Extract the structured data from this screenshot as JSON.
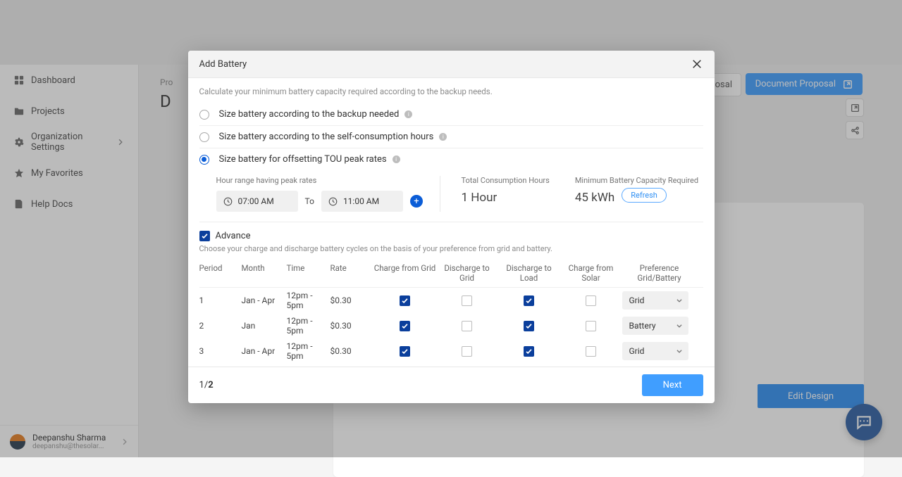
{
  "sidebar": {
    "items": [
      {
        "label": "Dashboard",
        "icon": "grid"
      },
      {
        "label": "Projects",
        "icon": "folder"
      },
      {
        "label": "Organization Settings",
        "icon": "gear",
        "expandable": true
      },
      {
        "label": "My Favorites",
        "icon": "star"
      },
      {
        "label": "Help Docs",
        "icon": "doc"
      }
    ],
    "user": {
      "name": "Deepanshu Sharma",
      "email": "deepanshu@thesolar..."
    }
  },
  "page": {
    "breadcrumb": "Pro",
    "title_initial": "D",
    "doc_proposal": "Document Proposal",
    "ghost_suffix": "osal",
    "edit_design": "Edit Design"
  },
  "modal": {
    "title": "Add Battery",
    "subtitle": "Calculate your minimum battery capacity required according to the backup needs.",
    "options": [
      {
        "label": "Size battery according to the backup needed",
        "selected": false
      },
      {
        "label": "Size battery according to the self-consumption hours",
        "selected": false
      },
      {
        "label": "Size battery for offsetting TOU peak rates",
        "selected": true
      }
    ],
    "hour_range_label": "Hour range having peak rates",
    "from_time": "07:00 AM",
    "to_label": "To",
    "to_time": "11:00 AM",
    "stats": {
      "total_label": "Total Consumption Hours",
      "total_value": "1 Hour",
      "min_label": "Minimum Battery Capacity Required",
      "min_value": "45 kWh",
      "refresh": "Refresh"
    },
    "advance_label": "Advance",
    "advance_checked": true,
    "advance_desc": "Choose your charge and discharge battery cycles on the basis of your preference from grid and battery.",
    "columns": [
      "Period",
      "Month",
      "Time",
      "Rate",
      "Charge from Grid",
      "Discharge to Grid",
      "Discharge to Load",
      "Charge from Solar",
      "Preference Grid/Battery"
    ],
    "rows": [
      {
        "period": "1",
        "month": "Jan - Apr",
        "time": "12pm - 5pm",
        "rate": "$0.30",
        "c_grid": true,
        "d_grid": false,
        "d_load": true,
        "c_solar": false,
        "pref": "Grid"
      },
      {
        "period": "2",
        "month": "Jan",
        "time": "12pm - 5pm",
        "rate": "$0.30",
        "c_grid": true,
        "d_grid": false,
        "d_load": true,
        "c_solar": false,
        "pref": "Battery"
      },
      {
        "period": "3",
        "month": "Jan - Apr",
        "time": "12pm - 5pm",
        "rate": "$0.30",
        "c_grid": true,
        "d_grid": false,
        "d_load": true,
        "c_solar": false,
        "pref": "Grid"
      }
    ],
    "pager_current": "1",
    "pager_total": "2",
    "next": "Next"
  }
}
